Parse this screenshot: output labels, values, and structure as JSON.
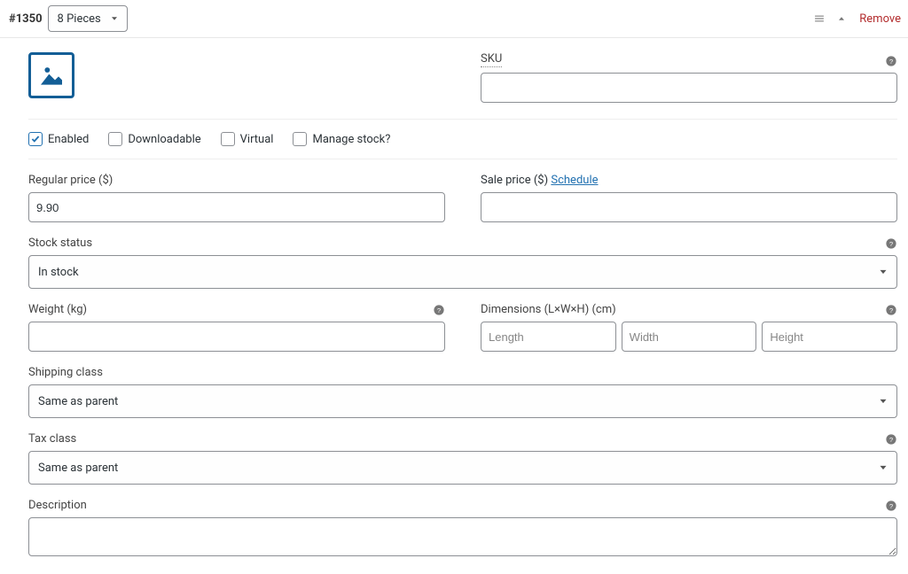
{
  "header": {
    "id": "#1350",
    "variation_select": "8 Pieces",
    "remove_label": "Remove"
  },
  "image": {
    "alt": "variation-image"
  },
  "sku": {
    "label": "SKU",
    "value": ""
  },
  "toggles": {
    "enabled": {
      "label": "Enabled",
      "checked": true
    },
    "downloadable": {
      "label": "Downloadable",
      "checked": false
    },
    "virtual": {
      "label": "Virtual",
      "checked": false
    },
    "manage_stock": {
      "label": "Manage stock?",
      "checked": false
    }
  },
  "regular_price": {
    "label": "Regular price ($)",
    "value": "9.90"
  },
  "sale_price": {
    "label": "Sale price ($)",
    "schedule_label": "Schedule",
    "value": ""
  },
  "stock_status": {
    "label": "Stock status",
    "value": "In stock"
  },
  "weight": {
    "label": "Weight (kg)",
    "value": ""
  },
  "dimensions": {
    "label": "Dimensions (L×W×H) (cm)",
    "length_placeholder": "Length",
    "width_placeholder": "Width",
    "height_placeholder": "Height",
    "length": "",
    "width": "",
    "height": ""
  },
  "shipping_class": {
    "label": "Shipping class",
    "value": "Same as parent"
  },
  "tax_class": {
    "label": "Tax class",
    "value": "Same as parent"
  },
  "description": {
    "label": "Description",
    "value": ""
  }
}
